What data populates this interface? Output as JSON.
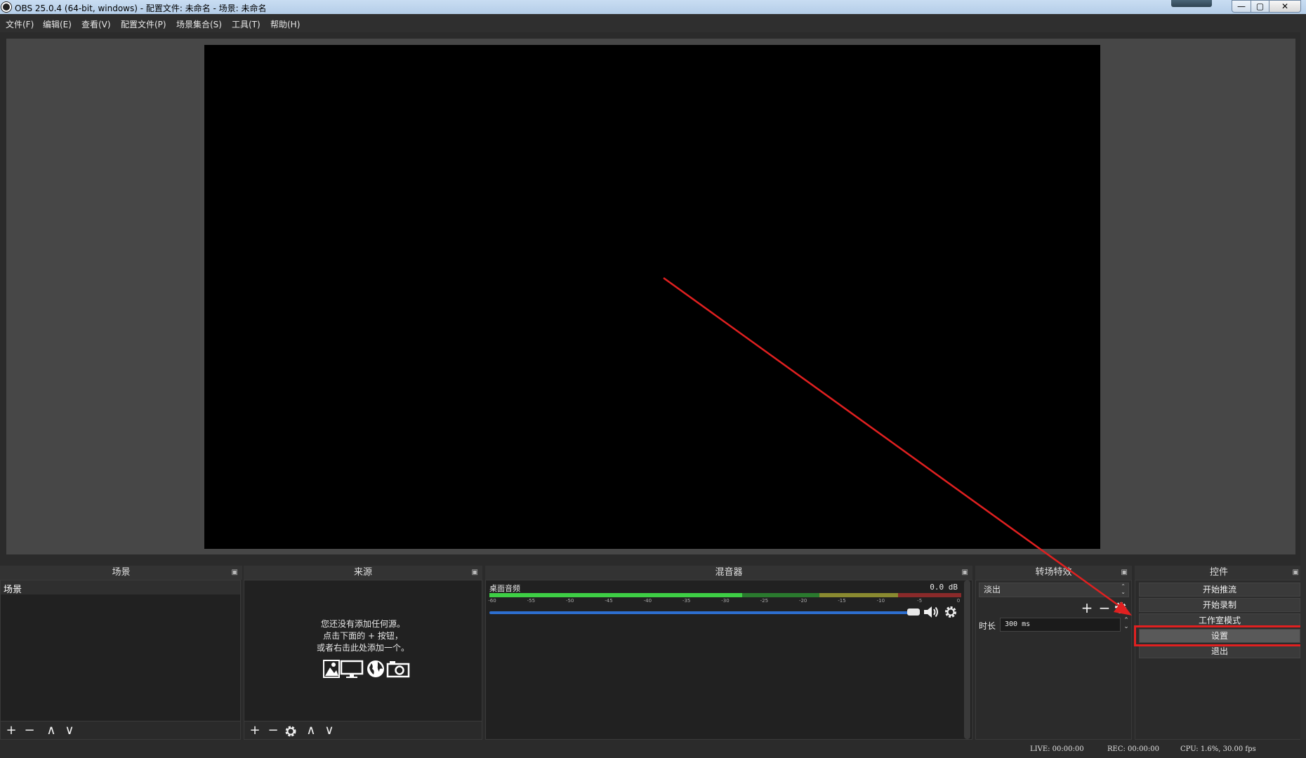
{
  "window": {
    "title": "OBS 25.0.4 (64-bit, windows) - 配置文件: 未命名 - 场景: 未命名",
    "minimize_glyph": "—",
    "maximize_glyph": "▢",
    "close_glyph": "✕"
  },
  "menubar": {
    "items": [
      "文件(F)",
      "编辑(E)",
      "查看(V)",
      "配置文件(P)",
      "场景集合(S)",
      "工具(T)",
      "帮助(H)"
    ]
  },
  "docks": {
    "scenes": {
      "title": "场景",
      "items": [
        "场景"
      ]
    },
    "sources": {
      "title": "来源",
      "empty_hint": [
        "您还没有添加任何源。",
        "点击下面的 + 按钮，",
        "或者右击此处添加一个。"
      ]
    },
    "mixer": {
      "title": "混音器",
      "track_name": "桌面音频",
      "level": "0.0 dB",
      "volume_fraction": 1.0,
      "ticks": [
        "-60",
        "-55",
        "-50",
        "-45",
        "-40",
        "-35",
        "-30",
        "-25",
        "-20",
        "-15",
        "-10",
        "-5",
        "0"
      ]
    },
    "transitions": {
      "title": "转场特效",
      "selected": "淡出",
      "duration_label": "时长",
      "duration_value": "300 ms"
    },
    "controls": {
      "title": "控件",
      "buttons": [
        "开始推流",
        "开始录制",
        "工作室模式",
        "设置",
        "退出"
      ]
    }
  },
  "toolbar_glyphs": {
    "add": "+",
    "remove": "−",
    "up": "∧",
    "down": "∨"
  },
  "status": {
    "live": "LIVE: 00:00:00",
    "rec": "REC: 00:00:00",
    "cpu": "CPU: 1.6%, 30.00 fps"
  },
  "colors": {
    "highlight": "#e02020",
    "meter_green": "#3ecf45",
    "meter_yellow": "#c9c83a",
    "meter_red": "#c83a3a",
    "fader_blue": "#2d6fd0"
  }
}
